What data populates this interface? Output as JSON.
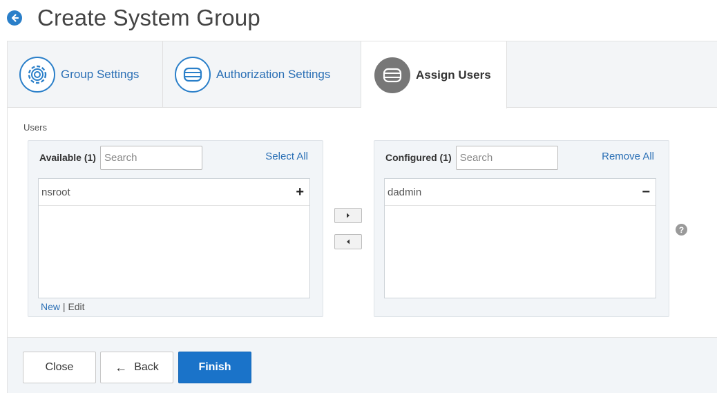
{
  "header": {
    "title": "Create System Group",
    "back_icon": "arrow-left-circle-icon"
  },
  "tabs": [
    {
      "label": "Group Settings",
      "icon": "gear-icon",
      "active": false
    },
    {
      "label": "Authorization Settings",
      "icon": "server-icon",
      "active": false
    },
    {
      "label": "Assign Users",
      "icon": "server-icon",
      "active": true
    }
  ],
  "users": {
    "label": "Users",
    "available": {
      "title": "Available (1)",
      "search_placeholder": "Search",
      "action": "Select All",
      "items": [
        "nsroot"
      ],
      "item_action": "+",
      "link_new": "New",
      "link_sep": " | ",
      "link_edit": "Edit"
    },
    "configured": {
      "title": "Configured (1)",
      "search_placeholder": "Search",
      "action": "Remove All",
      "items": [
        "dadmin"
      ],
      "item_action": "−"
    },
    "help": "?"
  },
  "footer": {
    "close_label": "Close",
    "back_label": "Back",
    "back_arrow": "←",
    "finish_label": "Finish"
  },
  "colors": {
    "accent": "#1a73c9",
    "link": "#2a6fb5",
    "panel_bg": "#f2f5f8"
  }
}
